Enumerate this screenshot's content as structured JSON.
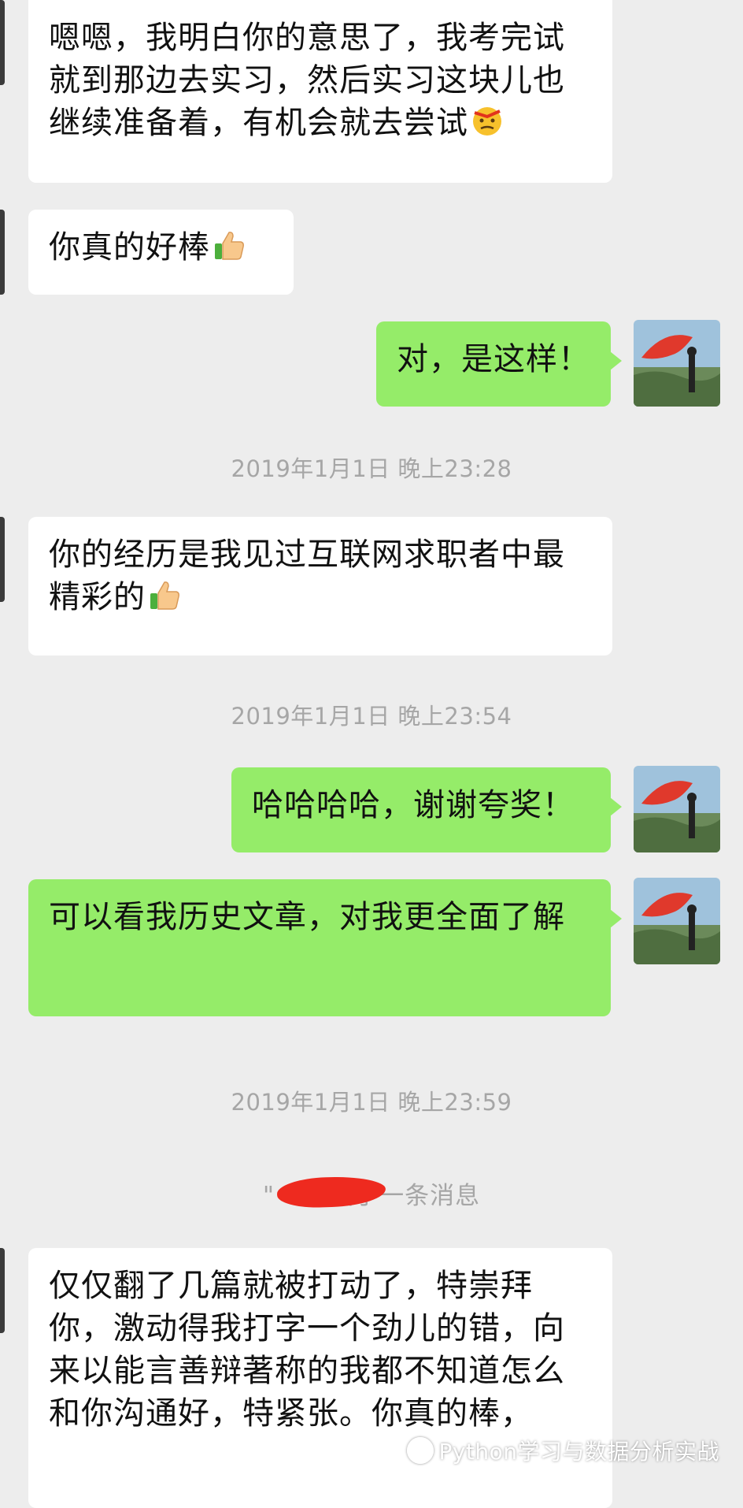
{
  "messages": [
    {
      "sender": "other",
      "text": "嗯嗯，我明白你的意思了，我考完试就到那边去实习，然后实习这块儿也继续准备着，有机会就去尝试",
      "emoji": "frustrated-face-emoji"
    },
    {
      "sender": "other",
      "text": "你真的好棒",
      "emoji": "thumbs-up-emoji"
    },
    {
      "sender": "self",
      "text": "对，是这样！"
    },
    {
      "timestamp": "2019年1月1日 晚上23:28"
    },
    {
      "sender": "other",
      "text": "你的经历是我见过互联网求职者中最精彩的",
      "emoji": "thumbs-up-emoji"
    },
    {
      "timestamp": "2019年1月1日 晚上23:54"
    },
    {
      "sender": "self",
      "text": "哈哈哈哈，谢谢夸奖！"
    },
    {
      "sender": "self",
      "text": "可以看我历史文章，对我更全面了解"
    },
    {
      "timestamp": "2019年1月1日 晚上23:59"
    },
    {
      "recall_notice": "\"    \" 撤回了一条消息"
    },
    {
      "sender": "other",
      "text": "仅仅翻了几篇就被打动了，特崇拜你，激动得我打字一个劲儿的错，向来以能言善辩著称的我都不知道怎么和你沟通好，特紧张。你真的棒，"
    }
  ],
  "watermark": {
    "text": "Python学习与数据分析实战",
    "icon": "wechat-icon"
  },
  "colors": {
    "background": "#ededed",
    "incoming_bubble": "#ffffff",
    "outgoing_bubble": "#95ec69",
    "timestamp_text": "#a6a6a6",
    "redaction": "#ee2a1f"
  }
}
